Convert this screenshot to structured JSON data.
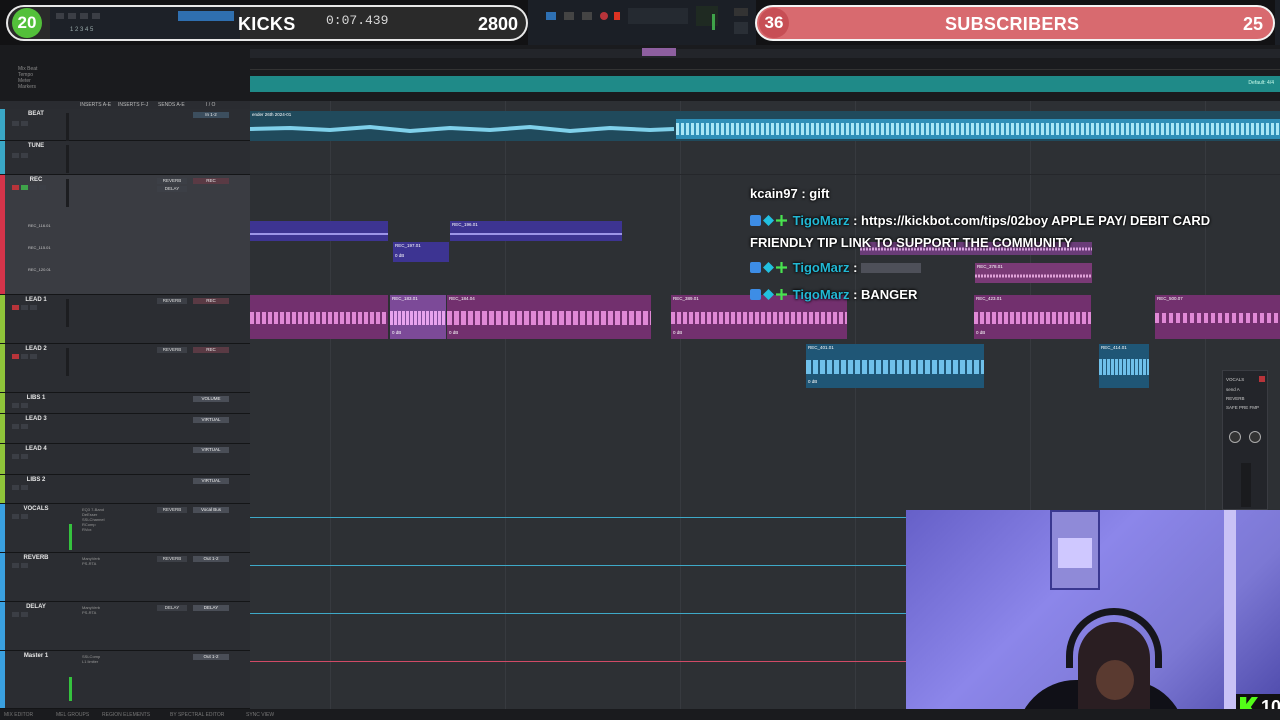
{
  "stream_overlay": {
    "kicks_goal": {
      "current": "20",
      "label": "KICKS",
      "target": "2800"
    },
    "subscribers_goal": {
      "current": "36",
      "label": "SUBSCRIBERS",
      "target": "25"
    },
    "time_readout": "0:07.439",
    "kick_badge_count": "10"
  },
  "ruler": {
    "labels": [
      "Mix Beat",
      "Tempo",
      "Meter",
      "Markers"
    ],
    "default_label": "Default: 4/4"
  },
  "column_headers": {
    "inserts_a_e": "INSERTS A-E",
    "inserts_f_j": "INSERTS F-J",
    "sends_a_e": "SENDS A-E",
    "io": "I / O"
  },
  "tracks": [
    {
      "name": "BEAT",
      "color": "#3aa7c6",
      "send": "",
      "io": "In 1-2"
    },
    {
      "name": "TUNE",
      "color": "#3aa7c6",
      "send": "",
      "io": ""
    },
    {
      "name": "REC",
      "color": "#d4344a",
      "send": "REVERB",
      "io": "REC",
      "playlists": [
        "REC_116.01",
        "REC_115.01",
        "REC_120.01"
      ]
    },
    {
      "name": "LEAD 1",
      "color": "#8fc43a",
      "send": "REVERB",
      "io": "REC"
    },
    {
      "name": "LEAD 2",
      "color": "#8fc43a",
      "send": "REVERB",
      "io": "REC"
    },
    {
      "name": "LIBS 1",
      "color": "#8fc43a",
      "send": "",
      "io": "VOLUME"
    },
    {
      "name": "LEAD 3",
      "color": "#8fc43a",
      "send": "",
      "io": "VIRTUAL"
    },
    {
      "name": "LEAD 4",
      "color": "#8fc43a",
      "send": "",
      "io": "VIRTUAL"
    },
    {
      "name": "LIBS 2",
      "color": "#8fc43a",
      "send": "",
      "io": "VIRTUAL"
    },
    {
      "name": "VOCALS",
      "color": "#3aa0e0",
      "send": "REVERB",
      "io": "Vocal Bus",
      "inserts": [
        "EQ3 7-Band",
        "DeEsser",
        "SSLChannel",
        "RComp",
        "RVox"
      ]
    },
    {
      "name": "REVERB",
      "color": "#3aa0e0",
      "send": "REVERB",
      "io": "Out 1-2",
      "inserts": [
        "ManyVerb",
        "PS-RTA"
      ]
    },
    {
      "name": "DELAY",
      "color": "#3aa0e0",
      "send": "DELAY",
      "io": "DELAY",
      "inserts": [
        "ManyVerb",
        "PS-RTA"
      ]
    },
    {
      "name": "Master 1",
      "color": "#3aa0e0",
      "send": "",
      "io": "Out 1-2",
      "inserts": [
        "SSLComp",
        "L1 limiter"
      ]
    }
  ],
  "clips": {
    "beat": "ender 26th 2024-01",
    "rec": [
      "REC_196.01",
      "REC_197.01",
      "REC_378.01"
    ],
    "lead1": [
      "REC_183.01",
      "REC_184.04",
      "REC_389.01",
      "REC_423.01",
      "REC_500.07"
    ],
    "lead2": [
      "REC_401.01",
      "REC_414.01"
    ],
    "clip_gain": "0 dB"
  },
  "chat": [
    {
      "user": "kcain97",
      "message": "gift",
      "badges": false
    },
    {
      "user": "TigoMarz",
      "message": "https://kickbot.com/tips/02boy APPLE PAY/ DEBIT CARD",
      "badges": true
    },
    {
      "user": "",
      "message": "FRIENDLY TIP LINK TO SUPPORT THE COMMUNITY",
      "badges": false
    },
    {
      "user": "TigoMarz",
      "message": "",
      "badges": true
    },
    {
      "user": "TigoMarz",
      "message": "BANGER",
      "badges": true
    }
  ],
  "mini_panel": {
    "title": "VOCALS",
    "items": [
      "send A",
      "REVERB",
      "SAFE PRE FMP"
    ]
  },
  "bottom_strip": [
    "MIX EDITOR",
    "MEL GROUPS",
    "REGION ELEMENTS",
    "BY SPECTRAL EDITOR",
    "SYNC VIEW"
  ],
  "colors": {
    "kicks_green": "#53c03a",
    "subscribers_red": "#d86a6f",
    "teal_ruler": "#1f8a88",
    "clip_purple": "#4a3c9e",
    "clip_magenta": "#a14a9e",
    "clip_blue": "#1f5c84",
    "beat_clip": "#1d6f96"
  }
}
